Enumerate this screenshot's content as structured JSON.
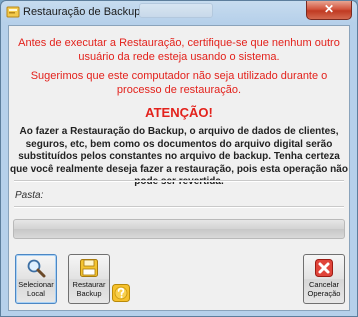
{
  "window": {
    "title": "Restauração de Backup",
    "close_glyph": "✕"
  },
  "messages": {
    "line1": "Antes de executar a Restauração, certifique-se que nenhum outro usuário da rede esteja usando o sistema.",
    "line2": "Sugerimos que este computador não seja utilizado durante o processo de restauração.",
    "attention": "ATENÇÃO!",
    "warning": "Ao fazer a Restauração do Backup, o arquivo de dados de clientes, seguros, etc, bem como os documentos do arquivo digital serão substituídos pelos constantes no arquivo de backup. Tenha certeza que você realmente deseja fazer a restauração, pois esta operação não pode ser revertida."
  },
  "folder": {
    "label": "Pasta:",
    "value": ""
  },
  "progress": {
    "fraction": 0
  },
  "buttons": {
    "select_local": {
      "line1": "Selecionar",
      "line2": "Local",
      "icon": "magnifier-icon"
    },
    "restore": {
      "line1": "Restaurar",
      "line2": "Backup",
      "icon": "floppy-disk-icon"
    },
    "help": {
      "icon": "help-icon"
    },
    "cancel": {
      "line1": "Cancelar",
      "line2": "Operação",
      "icon": "cancel-x-icon"
    }
  },
  "colors": {
    "message_red": "#e3221c",
    "window_frame": "#b6d0ea",
    "close_button": "#c8452c"
  }
}
